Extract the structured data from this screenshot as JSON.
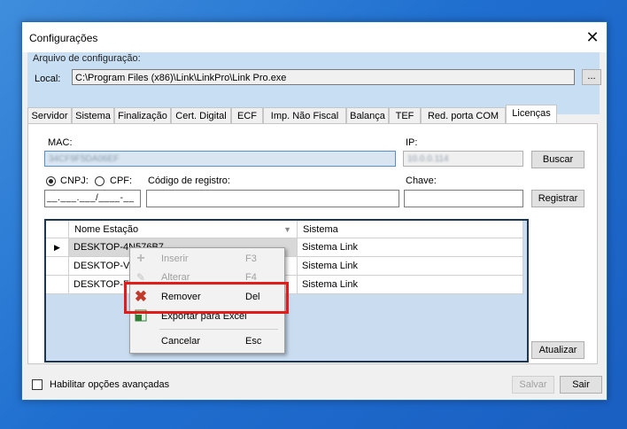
{
  "window": {
    "title": "Configurações",
    "close_glyph": "✕"
  },
  "config_file": {
    "legend": "Arquivo de configuração:",
    "local_label": "Local:",
    "path_value": "C:\\Program Files (x86)\\Link\\LinkPro\\Link Pro.exe",
    "browse_label": "..."
  },
  "tabs": [
    {
      "label": "Servidor"
    },
    {
      "label": "Sistema"
    },
    {
      "label": "Finalização"
    },
    {
      "label": "Cert. Digital"
    },
    {
      "label": "ECF"
    },
    {
      "label": "Imp. Não Fiscal"
    },
    {
      "label": "Balança"
    },
    {
      "label": "TEF"
    },
    {
      "label": "Red. porta COM"
    },
    {
      "label": "Licenças"
    }
  ],
  "active_tab": "Licenças",
  "license": {
    "mac_label": "MAC:",
    "mac_value": "34CF9F5DA06EF",
    "ip_label": "IP:",
    "ip_value": "10.0.0.114",
    "buscar_label": "Buscar",
    "cnpj_label": "CNPJ:",
    "cpf_label": "CPF:",
    "cnpj_selected": true,
    "doc_mask": "__.___.___/____-__",
    "codigo_label": "Código de registro:",
    "chave_label": "Chave:",
    "registrar_label": "Registrar",
    "atualizar_label": "Atualizar"
  },
  "grid": {
    "columns": [
      "Nome Estação",
      "Sistema"
    ],
    "rows": [
      {
        "station": "DESKTOP-4N576B7",
        "system": "Sistema Link",
        "current": true
      },
      {
        "station": "DESKTOP-VD",
        "system": "Sistema Link",
        "current": false
      },
      {
        "station": "DESKTOP-F",
        "system": "Sistema Link",
        "current": false
      }
    ]
  },
  "context_menu": {
    "items": [
      {
        "label": "Inserir",
        "shortcut": "F3",
        "icon": "plus-icon",
        "disabled": true
      },
      {
        "label": "Alterar",
        "shortcut": "F4",
        "icon": "pencil-icon",
        "disabled": true
      },
      {
        "label": "Remover",
        "shortcut": "Del",
        "icon": "red-x-icon",
        "disabled": false
      },
      {
        "label": "Exportar para Excel",
        "shortcut": "",
        "icon": "excel-icon",
        "disabled": false
      },
      {
        "label": "Cancelar",
        "shortcut": "Esc",
        "icon": "",
        "disabled": false
      }
    ],
    "highlight_color": "#e21b1b"
  },
  "footer": {
    "advanced_label": "Habilitar opções avançadas",
    "advanced_checked": false,
    "salvar_label": "Salvar",
    "salvar_enabled": false,
    "sair_label": "Sair"
  }
}
